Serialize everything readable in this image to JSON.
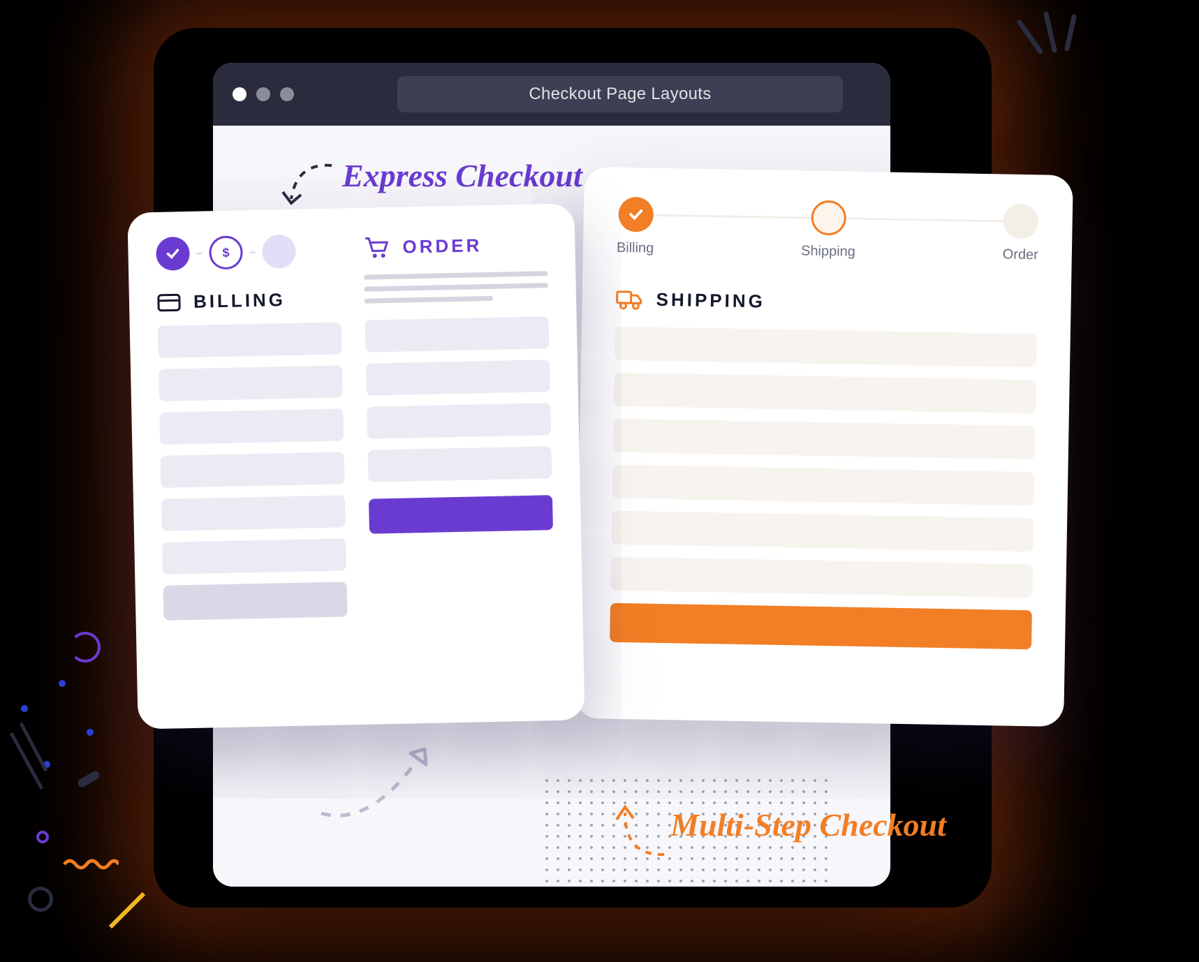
{
  "colors": {
    "purple": "#6a3bd1",
    "orange": "#f27e25",
    "titlebar": "#2a2c3e"
  },
  "browser": {
    "title": "Checkout Page Layouts"
  },
  "labels": {
    "express": "Express Checkout",
    "multistep": "Multi-Step Checkout"
  },
  "express": {
    "billing_heading": "BILLING",
    "order_heading": "ORDER",
    "steps": {
      "step1_icon": "checkmark-icon",
      "step2_icon": "dollar-icon",
      "step3_icon": ""
    }
  },
  "multistep": {
    "heading": "SHIPPING",
    "steps": {
      "billing": "Billing",
      "shipping": "Shipping",
      "order": "Order"
    }
  }
}
